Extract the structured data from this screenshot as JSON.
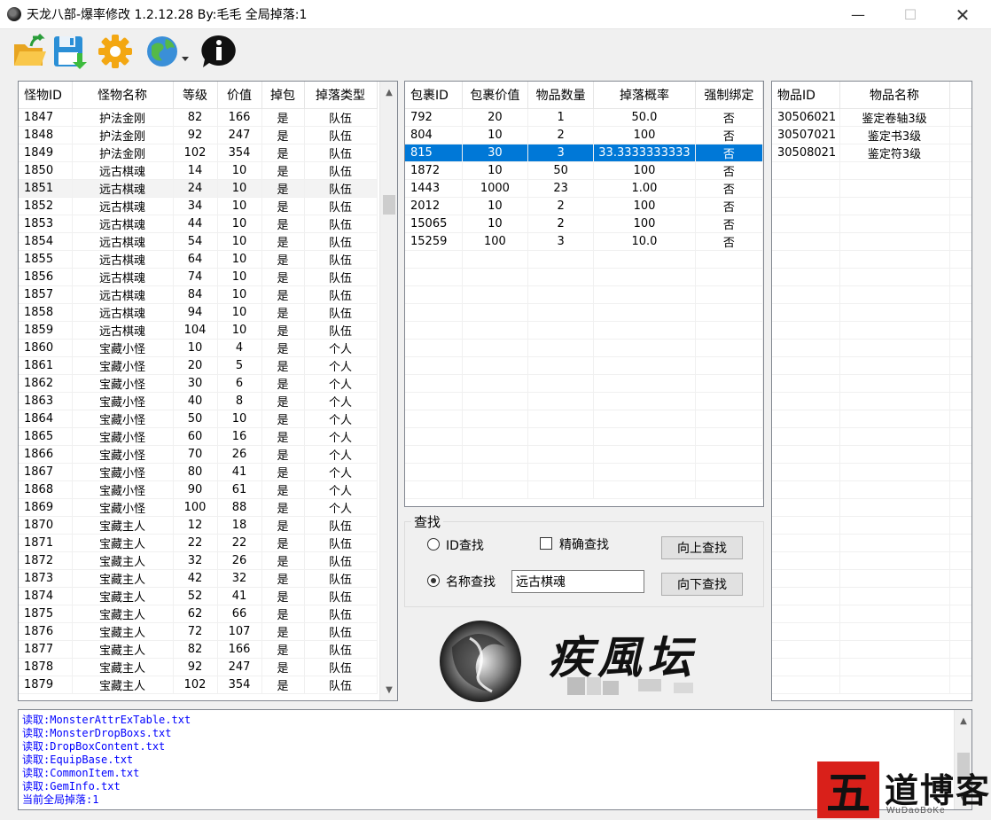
{
  "window": {
    "title": "天龙八部-爆率修改 1.2.12.28 By:毛毛  全局掉落:1",
    "controls": {
      "minimize": "—",
      "maximize": "☐",
      "close": "✕"
    }
  },
  "toolbar": {
    "buttons": [
      {
        "name": "open-folder-icon"
      },
      {
        "name": "save-icon"
      },
      {
        "name": "settings-gear-icon"
      },
      {
        "name": "globe-dropdown-icon"
      },
      {
        "name": "info-icon"
      }
    ]
  },
  "monster_table": {
    "columns": [
      "怪物ID",
      "怪物名称",
      "等级",
      "价值",
      "掉包",
      "掉落类型"
    ],
    "rows": [
      [
        "1847",
        "护法金刚",
        "82",
        "166",
        "是",
        "队伍"
      ],
      [
        "1848",
        "护法金刚",
        "92",
        "247",
        "是",
        "队伍"
      ],
      [
        "1849",
        "护法金刚",
        "102",
        "354",
        "是",
        "队伍"
      ],
      [
        "1850",
        "远古棋魂",
        "14",
        "10",
        "是",
        "队伍"
      ],
      [
        "1851",
        "远古棋魂",
        "24",
        "10",
        "是",
        "队伍"
      ],
      [
        "1852",
        "远古棋魂",
        "34",
        "10",
        "是",
        "队伍"
      ],
      [
        "1853",
        "远古棋魂",
        "44",
        "10",
        "是",
        "队伍"
      ],
      [
        "1854",
        "远古棋魂",
        "54",
        "10",
        "是",
        "队伍"
      ],
      [
        "1855",
        "远古棋魂",
        "64",
        "10",
        "是",
        "队伍"
      ],
      [
        "1856",
        "远古棋魂",
        "74",
        "10",
        "是",
        "队伍"
      ],
      [
        "1857",
        "远古棋魂",
        "84",
        "10",
        "是",
        "队伍"
      ],
      [
        "1858",
        "远古棋魂",
        "94",
        "10",
        "是",
        "队伍"
      ],
      [
        "1859",
        "远古棋魂",
        "104",
        "10",
        "是",
        "队伍"
      ],
      [
        "1860",
        "宝藏小怪",
        "10",
        "4",
        "是",
        "个人"
      ],
      [
        "1861",
        "宝藏小怪",
        "20",
        "5",
        "是",
        "个人"
      ],
      [
        "1862",
        "宝藏小怪",
        "30",
        "6",
        "是",
        "个人"
      ],
      [
        "1863",
        "宝藏小怪",
        "40",
        "8",
        "是",
        "个人"
      ],
      [
        "1864",
        "宝藏小怪",
        "50",
        "10",
        "是",
        "个人"
      ],
      [
        "1865",
        "宝藏小怪",
        "60",
        "16",
        "是",
        "个人"
      ],
      [
        "1866",
        "宝藏小怪",
        "70",
        "26",
        "是",
        "个人"
      ],
      [
        "1867",
        "宝藏小怪",
        "80",
        "41",
        "是",
        "个人"
      ],
      [
        "1868",
        "宝藏小怪",
        "90",
        "61",
        "是",
        "个人"
      ],
      [
        "1869",
        "宝藏小怪",
        "100",
        "88",
        "是",
        "个人"
      ],
      [
        "1870",
        "宝藏主人",
        "12",
        "18",
        "是",
        "队伍"
      ],
      [
        "1871",
        "宝藏主人",
        "22",
        "22",
        "是",
        "队伍"
      ],
      [
        "1872",
        "宝藏主人",
        "32",
        "26",
        "是",
        "队伍"
      ],
      [
        "1873",
        "宝藏主人",
        "42",
        "32",
        "是",
        "队伍"
      ],
      [
        "1874",
        "宝藏主人",
        "52",
        "41",
        "是",
        "队伍"
      ],
      [
        "1875",
        "宝藏主人",
        "62",
        "66",
        "是",
        "队伍"
      ],
      [
        "1876",
        "宝藏主人",
        "72",
        "107",
        "是",
        "队伍"
      ],
      [
        "1877",
        "宝藏主人",
        "82",
        "166",
        "是",
        "队伍"
      ],
      [
        "1878",
        "宝藏主人",
        "92",
        "247",
        "是",
        "队伍"
      ],
      [
        "1879",
        "宝藏主人",
        "102",
        "354",
        "是",
        "队伍"
      ]
    ],
    "hover_row": "1851"
  },
  "drop_table": {
    "columns": [
      "包裹ID",
      "包裹价值",
      "物品数量",
      "掉落概率",
      "强制绑定"
    ],
    "rows": [
      [
        "792",
        "20",
        "1",
        "50.0",
        "否"
      ],
      [
        "804",
        "10",
        "2",
        "100",
        "否"
      ],
      [
        "815",
        "30",
        "3",
        "33.3333333333",
        "否"
      ],
      [
        "1872",
        "10",
        "50",
        "100",
        "否"
      ],
      [
        "1443",
        "1000",
        "23",
        "1.00",
        "否"
      ],
      [
        "2012",
        "10",
        "2",
        "100",
        "否"
      ],
      [
        "15065",
        "10",
        "2",
        "100",
        "否"
      ],
      [
        "15259",
        "100",
        "3",
        "10.0",
        "否"
      ]
    ],
    "selected_row": "815"
  },
  "item_table": {
    "columns": [
      "物品ID",
      "物品名称"
    ],
    "rows": [
      [
        "30506021",
        "鉴定卷轴3级"
      ],
      [
        "30507021",
        "鉴定书3级"
      ],
      [
        "30508021",
        "鉴定符3级"
      ]
    ]
  },
  "search": {
    "legend": "查找",
    "id_search_label": "ID查找",
    "exact_search_label": "精确查找",
    "name_search_label": "名称查找",
    "search_up_label": "向上查找",
    "search_down_label": "向下查找",
    "query_value": "远古棋魂",
    "mode": "name",
    "exact": false
  },
  "logo": {
    "text": "疾風坛"
  },
  "watermark": {
    "seal": "五",
    "text": "道博客",
    "sub": "WuDaoBoKe"
  },
  "log": {
    "lines": [
      "读取:MonsterAttrExTable.txt",
      "读取:MonsterDropBoxs.txt",
      "读取:DropBoxContent.txt",
      "读取:EquipBase.txt",
      "读取:CommonItem.txt",
      "读取:GemInfo.txt",
      "当前全局掉落:1"
    ]
  },
  "colors": {
    "selection": "#0078d7",
    "log_text": "#0000ff",
    "window_bg": "#f0f0f0"
  }
}
